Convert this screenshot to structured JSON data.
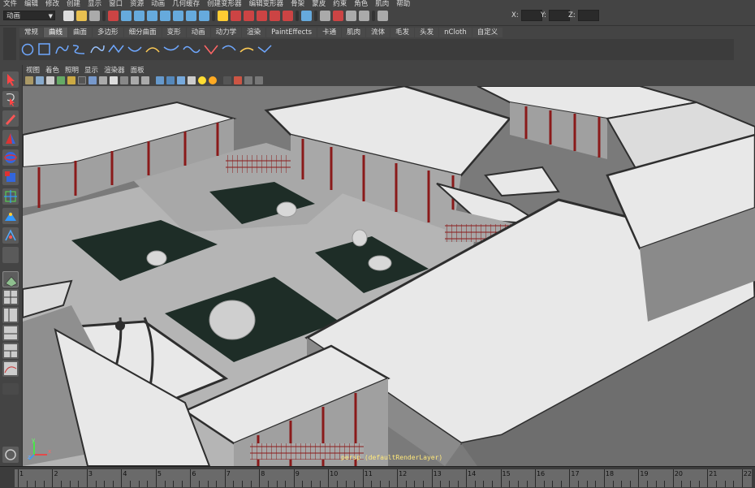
{
  "menubar": {
    "items": [
      "文件",
      "编辑",
      "修改",
      "创建",
      "显示",
      "窗口",
      "资源",
      "动画",
      "几何缓存",
      "创建变形器",
      "编辑变形器",
      "骨架",
      "蒙皮",
      "约束",
      "角色",
      "肌肉",
      "帮助"
    ]
  },
  "status_line": {
    "mode": "动画",
    "x_label": "X:",
    "y_label": "Y:",
    "z_label": "Z:"
  },
  "shelf": {
    "tabs": [
      "常规",
      "曲线",
      "曲面",
      "多边形",
      "细分曲面",
      "变形",
      "动画",
      "动力学",
      "渲染",
      "PaintEffects",
      "卡通",
      "肌肉",
      "流体",
      "毛发",
      "头发",
      "nCloth",
      "自定义"
    ],
    "active_tab": "曲线"
  },
  "panel": {
    "menus": [
      "视图",
      "着色",
      "照明",
      "显示",
      "渲染器",
      "面板"
    ]
  },
  "viewport": {
    "camera_label": "persp (defaultRenderLayer)",
    "colors": {
      "background": "#7a7a7a",
      "roof": "#e8e8e8",
      "roof_edge": "#2e2e2e",
      "pillar": "#8a1a1a",
      "courtyard_floor": "#b5b5b5",
      "garden": "#1e2d27"
    }
  },
  "timeline": {
    "ticks": [
      "1",
      "2",
      "3",
      "4",
      "5",
      "6",
      "7",
      "8",
      "9",
      "10",
      "11",
      "12",
      "13",
      "14",
      "15",
      "16",
      "17",
      "18",
      "19",
      "20",
      "21",
      "22"
    ]
  },
  "axis_gizmo": {
    "x": "x",
    "y": "y",
    "z": "z"
  }
}
